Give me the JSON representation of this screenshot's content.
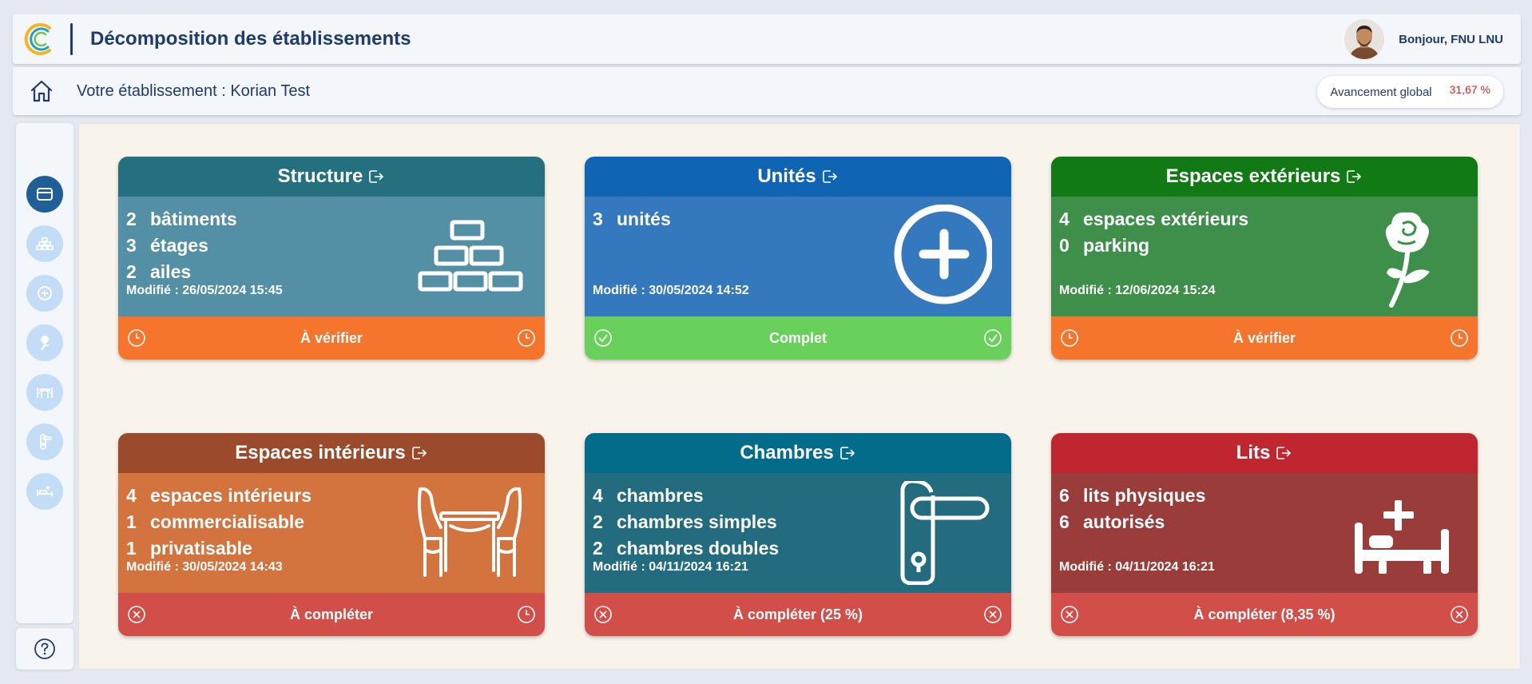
{
  "header": {
    "title": "Décomposition des établissements",
    "greeting": "Bonjour, FNU LNU"
  },
  "subheader": {
    "establishment": "Votre établissement : Korian Test",
    "progress_label": "Avancement global",
    "progress_value": "31,67 %"
  },
  "sidebar": {
    "items": [
      {
        "icon": "cards-icon",
        "active": true
      },
      {
        "icon": "bricks-icon",
        "active": false
      },
      {
        "icon": "plus-circle-icon",
        "active": false
      },
      {
        "icon": "rose-icon",
        "active": false
      },
      {
        "icon": "table-chairs-icon",
        "active": false
      },
      {
        "icon": "door-handle-icon",
        "active": false
      },
      {
        "icon": "bed-icon",
        "active": false
      }
    ],
    "help_icon": "help-icon"
  },
  "cards": [
    {
      "title": "Structure",
      "stats": [
        {
          "n": "2",
          "label": "bâtiments"
        },
        {
          "n": "3",
          "label": "étages"
        },
        {
          "n": "2",
          "label": "ailes"
        }
      ],
      "modified": "Modifié : 26/05/2024 15:45",
      "status": "À vérifier",
      "status_icon": "clock-icon",
      "illustration": "bricks-icon",
      "colors": {
        "header": "#24707f",
        "body": "#5390a5",
        "footer": "#f4752b"
      }
    },
    {
      "title": "Unités",
      "stats": [
        {
          "n": "3",
          "label": "unités"
        }
      ],
      "modified": "Modifié : 30/05/2024 14:52",
      "status": "Complet",
      "status_icon": "check-circle-icon",
      "illustration": "plus-circle-icon",
      "colors": {
        "header": "#0f64b4",
        "body": "#3479bd",
        "footer": "#69d05b"
      }
    },
    {
      "title": "Espaces extérieurs",
      "stats": [
        {
          "n": "4",
          "label": "espaces extérieurs"
        },
        {
          "n": "0",
          "label": "parking"
        }
      ],
      "modified": "Modifié : 12/06/2024 15:24",
      "status": "À vérifier",
      "status_icon": "clock-icon",
      "illustration": "rose-icon",
      "colors": {
        "header": "#127a14",
        "body": "#3d8f49",
        "footer": "#f4752b"
      }
    },
    {
      "title": "Espaces intérieurs",
      "stats": [
        {
          "n": "4",
          "label": "espaces intérieurs"
        },
        {
          "n": "1",
          "label": "commercialisable"
        },
        {
          "n": "1",
          "label": "privatisable"
        }
      ],
      "modified": "Modifié : 30/05/2024 14:43",
      "status": "À compléter",
      "status_icon": "x-circle-icon",
      "status_icon_right": "clock-icon",
      "illustration": "table-chairs-icon",
      "colors": {
        "header": "#9c4a2c",
        "body": "#d3743f",
        "footer": "#d24e49"
      }
    },
    {
      "title": "Chambres",
      "stats": [
        {
          "n": "4",
          "label": "chambres"
        },
        {
          "n": "2",
          "label": "chambres simples"
        },
        {
          "n": "2",
          "label": "chambres doubles"
        }
      ],
      "modified": "Modifié : 04/11/2024 16:21",
      "status": "À compléter (25 %)",
      "status_icon": "x-circle-icon",
      "illustration": "door-handle-icon",
      "colors": {
        "header": "#036c8b",
        "body": "#236c80",
        "footer": "#d24e49"
      }
    },
    {
      "title": "Lits",
      "stats": [
        {
          "n": "6",
          "label": "lits physiques"
        },
        {
          "n": "6",
          "label": "autorisés"
        }
      ],
      "modified": "Modifié : 04/11/2024 16:21",
      "status": "À compléter (8,35 %)",
      "status_icon": "x-circle-icon",
      "illustration": "bed-icon",
      "colors": {
        "header": "#c0262f",
        "body": "#993c3a",
        "footer": "#d24e49"
      }
    }
  ]
}
